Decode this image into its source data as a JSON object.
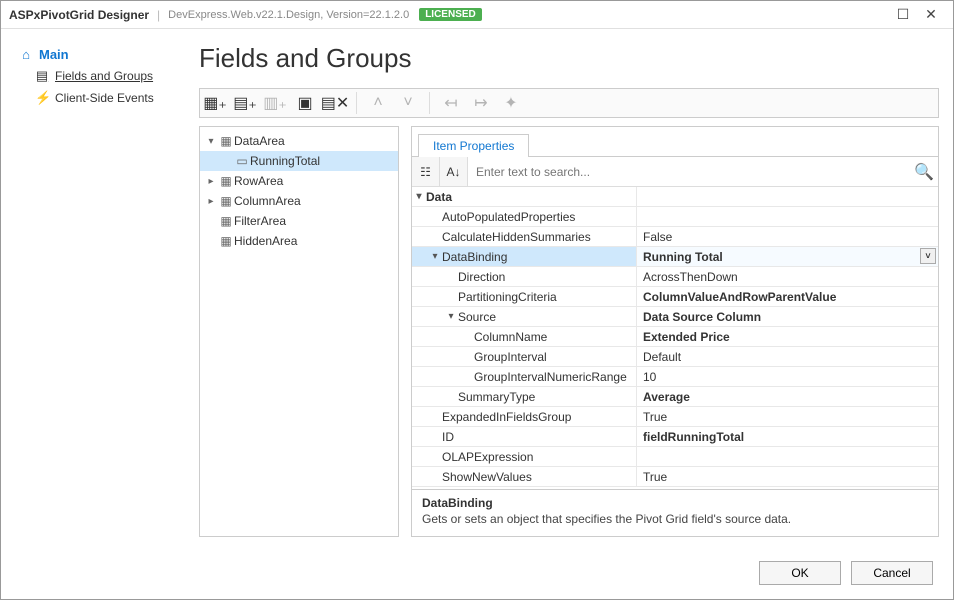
{
  "titlebar": {
    "title": "ASPxPivotGrid Designer",
    "version": "DevExpress.Web.v22.1.Design, Version=22.1.2.0",
    "license": "LICENSED"
  },
  "sidebar": {
    "main": "Main",
    "items": [
      {
        "icon": "layers-icon",
        "label": "Fields and Groups",
        "selected": true
      },
      {
        "icon": "bolt-icon",
        "label": "Client-Side Events",
        "selected": false
      }
    ]
  },
  "page": {
    "heading": "Fields and Groups"
  },
  "toolbar": {
    "buttons": [
      {
        "name": "add-field-button",
        "icon": "add-field-icon",
        "disabled": false
      },
      {
        "name": "add-group-button",
        "icon": "add-group-icon",
        "disabled": false
      },
      {
        "name": "add-subgroup-button",
        "icon": "add-subgroup-icon",
        "disabled": true
      },
      {
        "name": "edit-button",
        "icon": "edit-icon",
        "disabled": false
      },
      {
        "name": "delete-button",
        "icon": "delete-icon",
        "disabled": false
      },
      {
        "name": "sep1",
        "sep": true
      },
      {
        "name": "move-up-button",
        "icon": "chevron-up-icon",
        "disabled": true
      },
      {
        "name": "move-down-button",
        "icon": "chevron-down-icon",
        "disabled": true
      },
      {
        "name": "sep2",
        "sep": true
      },
      {
        "name": "indent-left-button",
        "icon": "indent-left-icon",
        "disabled": true
      },
      {
        "name": "indent-right-button",
        "icon": "indent-right-icon",
        "disabled": true
      },
      {
        "name": "wizard-button",
        "icon": "wand-icon",
        "disabled": true
      }
    ]
  },
  "tree": {
    "nodes": [
      {
        "depth": 0,
        "expander": "▾",
        "icon": "area-icon",
        "label": "DataArea",
        "selected": false
      },
      {
        "depth": 1,
        "expander": "",
        "icon": "field-icon",
        "label": "RunningTotal",
        "selected": true
      },
      {
        "depth": 0,
        "expander": "▸",
        "icon": "area-icon",
        "label": "RowArea",
        "selected": false
      },
      {
        "depth": 0,
        "expander": "▸",
        "icon": "area-icon",
        "label": "ColumnArea",
        "selected": false
      },
      {
        "depth": 0,
        "expander": "",
        "icon": "area-icon",
        "label": "FilterArea",
        "selected": false
      },
      {
        "depth": 0,
        "expander": "",
        "icon": "area-icon",
        "label": "HiddenArea",
        "selected": false
      }
    ]
  },
  "properties": {
    "tab": "Item Properties",
    "search_placeholder": "Enter text to search...",
    "rows": [
      {
        "kind": "cat",
        "indent": 0,
        "exp": "▾",
        "label": "Data",
        "value": ""
      },
      {
        "kind": "prop",
        "indent": 1,
        "exp": "",
        "label": "AutoPopulatedProperties",
        "value": ""
      },
      {
        "kind": "prop",
        "indent": 1,
        "exp": "",
        "label": "CalculateHiddenSummaries",
        "value": "False"
      },
      {
        "kind": "prop",
        "indent": 1,
        "exp": "▾",
        "label": "DataBinding",
        "value": "Running Total",
        "bold": true,
        "selected": true,
        "dropdown": true
      },
      {
        "kind": "prop",
        "indent": 2,
        "exp": "",
        "label": "Direction",
        "value": "AcrossThenDown"
      },
      {
        "kind": "prop",
        "indent": 2,
        "exp": "",
        "label": "PartitioningCriteria",
        "value": "ColumnValueAndRowParentValue",
        "bold": true
      },
      {
        "kind": "prop",
        "indent": 2,
        "exp": "▾",
        "label": "Source",
        "value": "Data Source Column",
        "bold": true
      },
      {
        "kind": "prop",
        "indent": 3,
        "exp": "",
        "label": "ColumnName",
        "value": "Extended Price",
        "bold": true
      },
      {
        "kind": "prop",
        "indent": 3,
        "exp": "",
        "label": "GroupInterval",
        "value": "Default"
      },
      {
        "kind": "prop",
        "indent": 3,
        "exp": "",
        "label": "GroupIntervalNumericRange",
        "value": "10"
      },
      {
        "kind": "prop",
        "indent": 2,
        "exp": "",
        "label": "SummaryType",
        "value": "Average",
        "bold": true
      },
      {
        "kind": "prop",
        "indent": 1,
        "exp": "",
        "label": "ExpandedInFieldsGroup",
        "value": "True"
      },
      {
        "kind": "prop",
        "indent": 1,
        "exp": "",
        "label": "ID",
        "value": "fieldRunningTotal",
        "bold": true
      },
      {
        "kind": "prop",
        "indent": 1,
        "exp": "",
        "label": "OLAPExpression",
        "value": ""
      },
      {
        "kind": "prop",
        "indent": 1,
        "exp": "",
        "label": "ShowNewValues",
        "value": "True"
      }
    ],
    "desc_title": "DataBinding",
    "desc_body": "Gets or sets an object that specifies the Pivot Grid field's source data."
  },
  "footer": {
    "ok": "OK",
    "cancel": "Cancel"
  },
  "icons": {
    "home-icon": "⌂",
    "layers-icon": "▤",
    "bolt-icon": "⚡",
    "add-field-icon": "▦₊",
    "add-group-icon": "▤₊",
    "add-subgroup-icon": "▥₊",
    "edit-icon": "▣",
    "delete-icon": "▤✕",
    "chevron-up-icon": "˄",
    "chevron-down-icon": "˅",
    "indent-left-icon": "↤",
    "indent-right-icon": "↦",
    "wand-icon": "✦",
    "area-icon": "▦",
    "field-icon": "▭",
    "categorized-icon": "☷",
    "alphabetical-icon": "A↓",
    "search-icon": "🔍",
    "dropdown-icon": "˅",
    "maximize-icon": "☐",
    "close-icon": "✕"
  }
}
